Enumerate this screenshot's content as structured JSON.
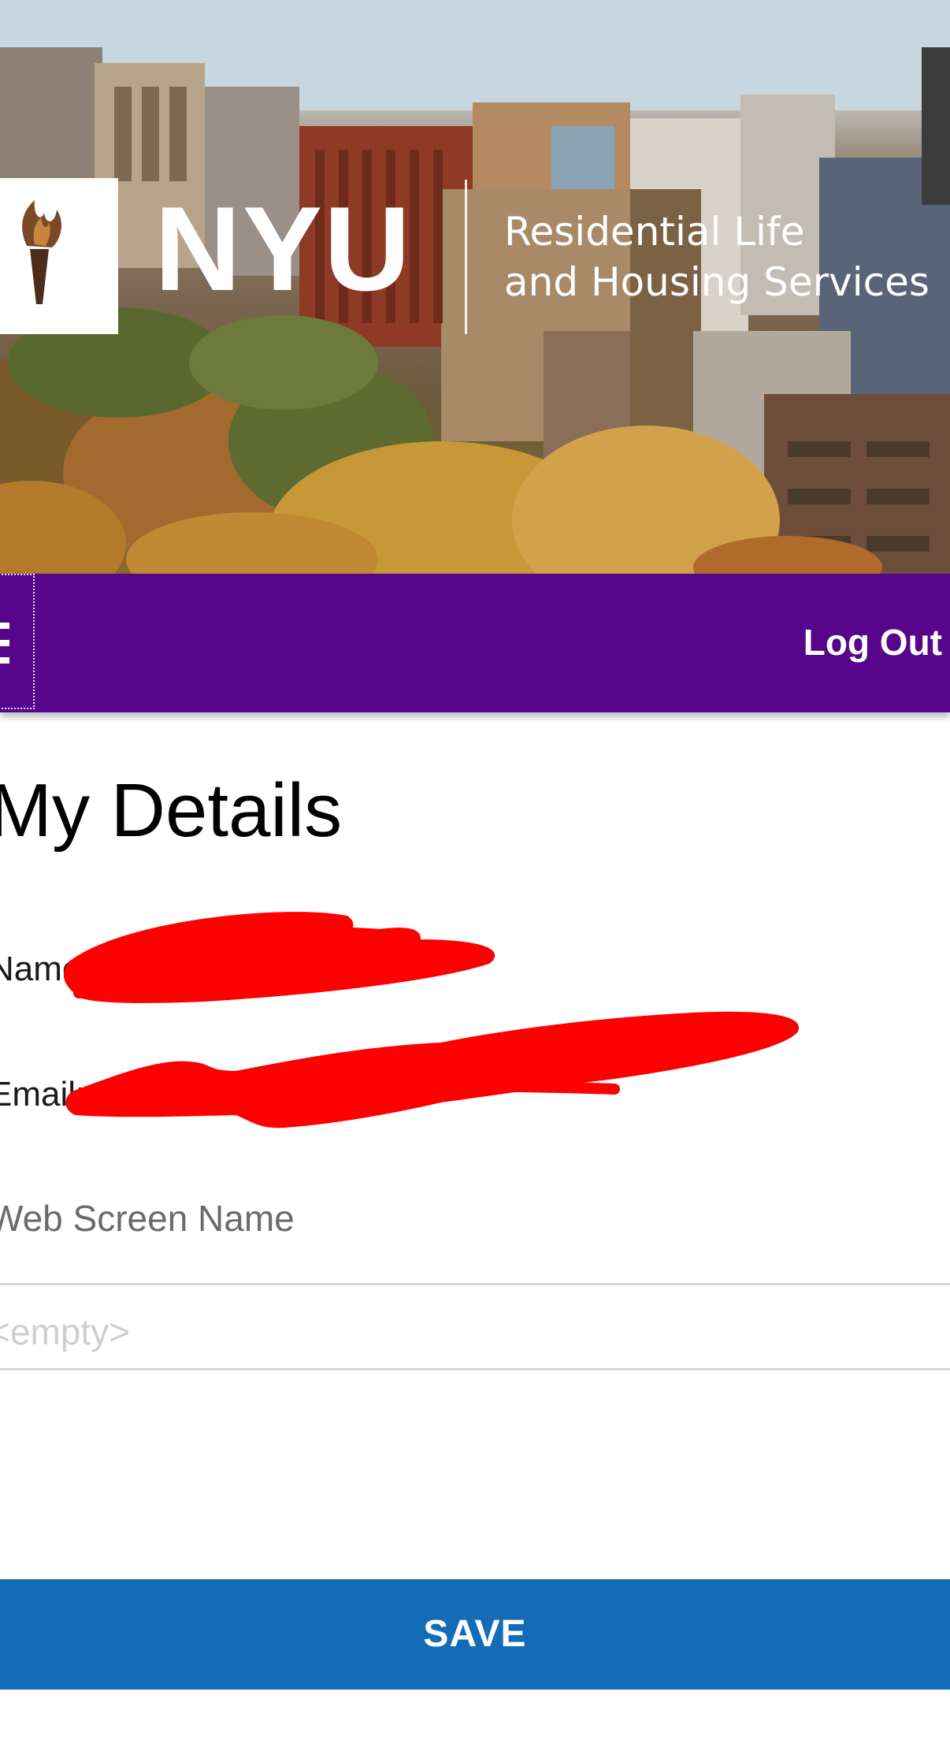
{
  "header": {
    "brand": "NYU",
    "subtitle_line1": "Residential Life",
    "subtitle_line2": "and Housing Services"
  },
  "nav": {
    "logout_label": "Log Out"
  },
  "main": {
    "title": "My Details",
    "name_label": "Name:",
    "name_value": "",
    "email_label": "Email:",
    "email_value": "",
    "screen_name_label": "Web Screen Name",
    "screen_name_placeholder": "<empty>",
    "screen_name_value": ""
  },
  "actions": {
    "save_label": "SAVE"
  },
  "colors": {
    "nav_background": "#57068c",
    "save_button": "#126cb6",
    "redaction": "#ff0000"
  }
}
